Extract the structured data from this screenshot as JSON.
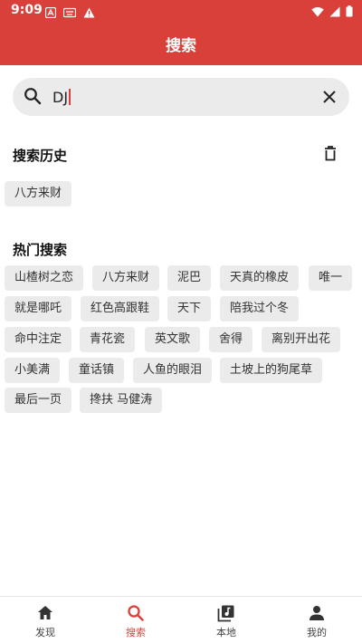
{
  "status_bar": {
    "time": "9:09"
  },
  "header": {
    "title": "搜索"
  },
  "search": {
    "value": "DJ"
  },
  "history": {
    "title": "搜索历史",
    "items": [
      "八方来财"
    ]
  },
  "hot": {
    "title": "热门搜索",
    "tags": [
      "山楂树之恋",
      "八方来财",
      "泥巴",
      "天真的橡皮",
      "唯一",
      "就是哪吒",
      "红色高跟鞋",
      "天下",
      "陪我过个冬",
      "命中注定",
      "青花瓷",
      "英文歌",
      "舍得",
      "离别开出花",
      "小美满",
      "童话镇",
      "人鱼的眼泪",
      "土坡上的狗尾草",
      "最后一页",
      "搀扶 马健涛"
    ]
  },
  "tabbar": {
    "tabs": [
      {
        "label": "发现",
        "icon": "home-icon"
      },
      {
        "label": "搜索",
        "icon": "search-icon"
      },
      {
        "label": "本地",
        "icon": "music-library-icon"
      },
      {
        "label": "我的",
        "icon": "person-icon"
      }
    ],
    "active_index": 1
  },
  "colors": {
    "brand": "#d9403a",
    "tag_bg": "#ebebeb"
  }
}
